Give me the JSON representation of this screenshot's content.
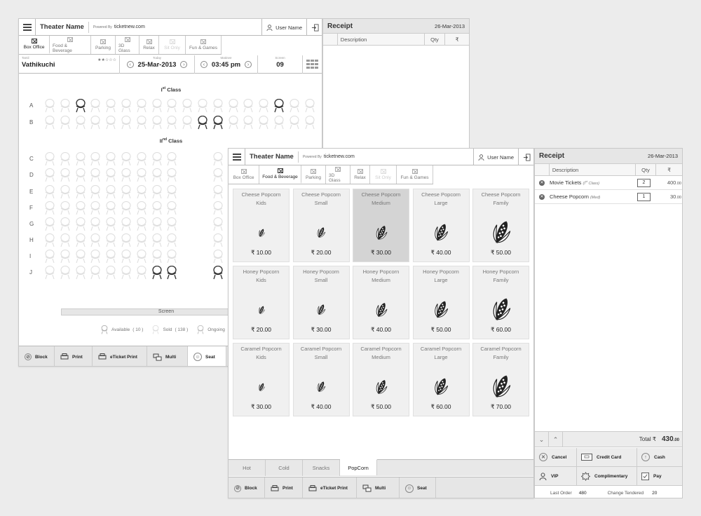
{
  "back": {
    "header": {
      "theater_name": "Theater Name",
      "powered_by": "Powered By",
      "site": "ticketnew.com",
      "user_name": "User Name"
    },
    "tabs": [
      "Box Office",
      "Food & Beverage",
      "Parking",
      "3D Glass",
      "Relax",
      "Sit Only",
      "Fun & Games"
    ],
    "info": {
      "movie_label": "Tamil",
      "movie": "Vathikuchi",
      "rating": "★★☆☆☆",
      "today_label": "Today",
      "date": "25-Mar-2013",
      "matinee_label": "Matinee",
      "time": "03:45 pm",
      "screen_label": "Screen",
      "screen": "09"
    },
    "first_class": "I",
    "first_class_sup": "st",
    "first_class_word": " Class",
    "second_class": "II",
    "second_class_sup": "nd",
    "second_class_word": " Class",
    "rows_first": [
      "A",
      "B"
    ],
    "rows_second": [
      "C",
      "D",
      "E",
      "F",
      "G",
      "H",
      "I",
      "J"
    ],
    "screen_label": "Screen",
    "legend": {
      "available": "Available",
      "available_count": "( 10 )",
      "sold": "Sold",
      "sold_count": "( 138 )",
      "ongoing": "Ongoing"
    },
    "bottom": [
      "Block",
      "Print",
      "eTicket Print",
      "Multi",
      "Seat"
    ],
    "receipt": {
      "title": "Receipt",
      "date": "26-Mar-2013",
      "col_desc": "Description",
      "col_qty": "Qty",
      "col_amt": "₹"
    }
  },
  "front": {
    "header": {
      "theater_name": "Theater Name",
      "powered_by": "Powered By",
      "site": "ticketnew.com",
      "user_name": "User Name"
    },
    "tabs": [
      "Box Office",
      "Food & Beverage",
      "Parking",
      "3D Glass",
      "Relax",
      "Sit Only",
      "Fun & Games"
    ],
    "products": [
      {
        "name": "Cheese Popcorn",
        "size": "Kids",
        "price": "₹ 10.00"
      },
      {
        "name": "Cheese Popcorn",
        "size": "Small",
        "price": "₹ 20.00"
      },
      {
        "name": "Cheese Popcorn",
        "size": "Medium",
        "price": "₹ 30.00"
      },
      {
        "name": "Cheese Popcorn",
        "size": "Large",
        "price": "₹ 40.00"
      },
      {
        "name": "Cheese Popcorn",
        "size": "Family",
        "price": "₹ 50.00"
      },
      {
        "name": "Honey Popcorn",
        "size": "Kids",
        "price": "₹ 20.00"
      },
      {
        "name": "Honey Popcorn",
        "size": "Small",
        "price": "₹ 30.00"
      },
      {
        "name": "Honey Popcorn",
        "size": "Medium",
        "price": "₹ 40.00"
      },
      {
        "name": "Honey Popcorn",
        "size": "Large",
        "price": "₹ 50.00"
      },
      {
        "name": "Honey Popcorn",
        "size": "Family",
        "price": "₹ 60.00"
      },
      {
        "name": "Caramel Popcorn",
        "size": "Kids",
        "price": "₹ 30.00"
      },
      {
        "name": "Caramel Popcorn",
        "size": "Small",
        "price": "₹ 40.00"
      },
      {
        "name": "Caramel Popcorn",
        "size": "Medium",
        "price": "₹ 50.00"
      },
      {
        "name": "Caramel Popcorn",
        "size": "Large",
        "price": "₹ 60.00"
      },
      {
        "name": "Caramel Popcorn",
        "size": "Family",
        "price": "₹ 70.00"
      }
    ],
    "category_tabs": [
      "Hot",
      "Cold",
      "Snacks",
      "PopCorn"
    ],
    "bottom": [
      "Block",
      "Print",
      "eTicket Print",
      "Multi",
      "Seat"
    ],
    "receipt": {
      "title": "Receipt",
      "date": "26-Mar-2013",
      "col_desc": "Description",
      "col_qty": "Qty",
      "col_amt": "₹",
      "items": [
        {
          "desc": "Movie Tickets",
          "note_a": "(I",
          "note_sup": "st",
          "note_b": " Class)",
          "qty": "2",
          "amount": "400",
          "cents": ".00"
        },
        {
          "desc": "Cheese Popcorn",
          "note": "(Med)",
          "qty": "1",
          "amount": "30",
          "cents": ".00"
        }
      ],
      "total_label": "Total ₹",
      "total": "430",
      "total_cents": ".00",
      "buttons": [
        "Cancel",
        "Credit Card",
        "Cash",
        "VIP",
        "Complimentary",
        "Pay"
      ],
      "last_order_label": "Last Order",
      "last_order": "480",
      "change_label": "Change Tendered",
      "change": "20"
    }
  }
}
